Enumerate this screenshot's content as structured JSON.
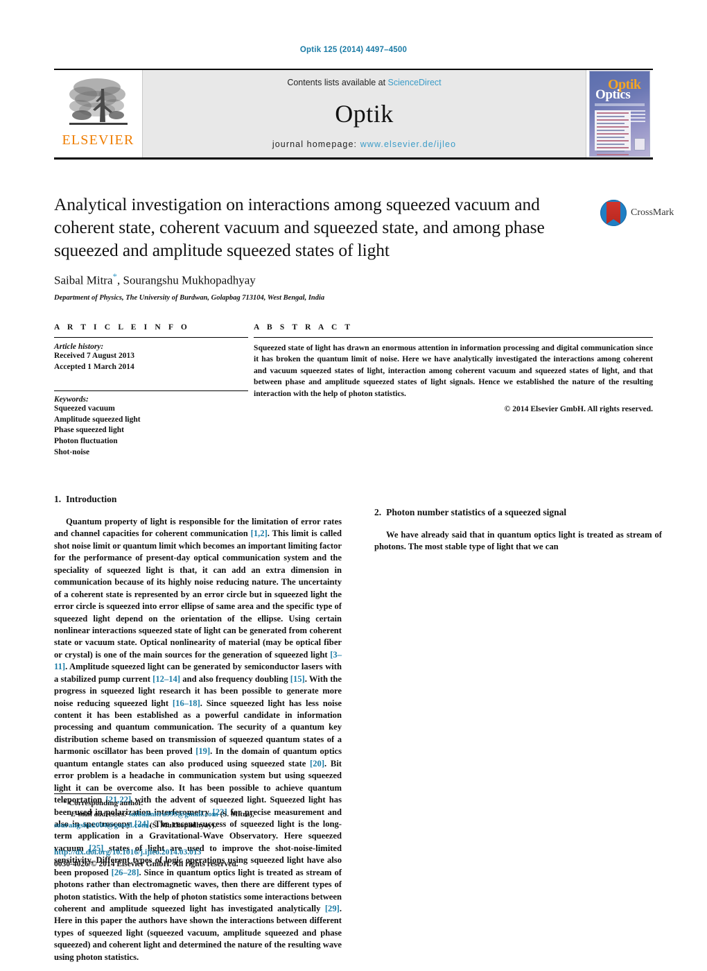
{
  "running_head": "Optik 125 (2014) 4497–4500",
  "masthead": {
    "publisher_name": "ELSEVIER",
    "publisher_logo": "elsevier-tree-logo",
    "contents_prefix": "Contents lists available at ",
    "contents_link": "ScienceDirect",
    "journal_name": "Optik",
    "homepage_prefix": "journal homepage: ",
    "homepage_url": "www.elsevier.de/ijleo",
    "cover": {
      "title_top": "Optik",
      "title_bottom": "Optics"
    }
  },
  "article": {
    "title": "Analytical investigation on interactions among squeezed vacuum and coherent state, coherent vacuum and squeezed state, and among phase squeezed and amplitude squeezed states of light",
    "authors": "Saibal Mitra",
    "corresponding_marker": "*",
    "authors_rest": ", Sourangshu Mukhopadhyay",
    "affiliation": "Department of Physics, The University of Burdwan, Golapbag 713104, West Bengal, India",
    "crossmark_label": "CrossMark"
  },
  "article_info": {
    "heading": "A R T I C L E   I N F O",
    "history_label": "Article history:",
    "history": [
      "Received 7 August 2013",
      "Accepted 1 March 2014"
    ],
    "keywords_label": "Keywords:",
    "keywords": [
      "Squeezed vacuum",
      "Amplitude squeezed light",
      "Phase squeezed light",
      "Photon fluctuation",
      "Shot-noise"
    ]
  },
  "abstract": {
    "heading": "A B S T R A C T",
    "text": "Squeezed state of light has drawn an enormous attention in information processing and digital communication since it has broken the quantum limit of noise. Here we have analytically investigated the interactions among coherent and vacuum squeezed states of light, interaction among coherent vacuum and squeezed states of light, and that between phase and amplitude squeezed states of light signals. Hence we established the nature of the resulting interaction with the help of photon statistics.",
    "copyright": "© 2014 Elsevier GmbH. All rights reserved."
  },
  "sections": {
    "intro": {
      "number": "1.",
      "title": "Introduction",
      "para1_a": "Quantum property of light is responsible for the limitation of error rates and channel capacities for coherent communication ",
      "cite1": "[1,2]",
      "para1_b": ". This limit is called shot noise limit or quantum limit which becomes an important limiting factor for the performance of present-day optical communication system and the speciality of squeezed light is that, it can add an extra dimension in communication because of its highly noise reducing nature. The uncertainty of a coherent state is represented by an error circle but in squeezed light the error circle is squeezed into error ellipse of same area and the specific type of squeezed light depend on the orientation of the ellipse. Using certain nonlinear interactions squeezed state of light can be generated from coherent state or vacuum state. Optical nonlinearity of material (may be optical fiber or crystal) is one of the main sources for the generation of squeezed light ",
      "cite2": "[3–11]",
      "para1_c": ". Amplitude squeezed light can be generated by semiconductor lasers with a stabilized pump current ",
      "cite3": "[12–14]",
      "para1_d": " and also frequency doubling ",
      "cite4": "[15]",
      "para1_e": ". With the progress in squeezed light research it has been possible to generate more noise reducing squeezed light ",
      "cite5": "[16–18]",
      "para1_f": ". Since squeezed light has less noise content it has been established as a powerful candidate in information processing and quantum communication. The security of a quantum key distribution scheme based on transmission of squeezed quantum states of a harmonic oscillator has been proved ",
      "cite6": "[19]",
      "para1_g": ". In the domain of quantum optics quantum entangle states can also produced using squeezed state ",
      "cite7": "[20]",
      "para1_h": ". Bit error problem is a headache in communication system but using squeezed light it can be overcome also. It has been possible to achieve quantum teleportation ",
      "cite8": "[21,22]",
      "para1_i": " with the advent of squeezed light. Squeezed light has been used in polarization interferometry ",
      "cite9": "[23]",
      "para1_j": " for precise measurement and also in spectroscopy ",
      "cite10": "[24]",
      "para1_k": ". The recent success of squeezed light is the long-term application in a Gravitational-Wave Observatory. Here squeezed vacuum ",
      "cite11": "[25]",
      "para1_l": " states of light are used to improve the shot-noise-limited sensitivity. Different types of logic operations using squeezed light have also been proposed ",
      "cite12": "[26–28]",
      "para1_m": ". Since in quantum optics light is treated as stream of photons rather than electromagnetic waves, then there are different types of photon statistics. With the help of photon statistics some interactions between coherent and amplitude squeezed light has investigated analytically ",
      "cite13": "[29]",
      "para1_n": ". Here in this paper the authors have shown the interactions between different types of squeezed light (squeezed vacuum, amplitude squeezed and phase squeezed) and coherent light and determined the nature of the resulting wave using photon statistics."
    },
    "photon_stats": {
      "number": "2.",
      "title": "Photon number statistics of a squeezed signal",
      "para1": "We have already said that in quantum optics light is treated as stream of photons. The most stable type of light that we can"
    }
  },
  "footnote": {
    "corresponding": "* Corresponding author.",
    "email_label": "E-mail addresses:",
    "email1": "saibalmitra999@gmail.com",
    "email1_owner": " (S. Mitra),",
    "email2": "sourangshu2004@gmail.com",
    "email2_owner": " (S. Mukhopadhyay).",
    "doi": "http://dx.doi.org/10.1016/j.ijleo.2014.03.013",
    "issn": "0030-4026/© 2014 Elsevier GmbH. All rights reserved."
  },
  "colors": {
    "link_blue": "#1b7ba5",
    "sciencedirect_blue": "#3b9cc8",
    "elsevier_orange": "#ef7d00",
    "masthead_grey": "#e8e8e8"
  }
}
